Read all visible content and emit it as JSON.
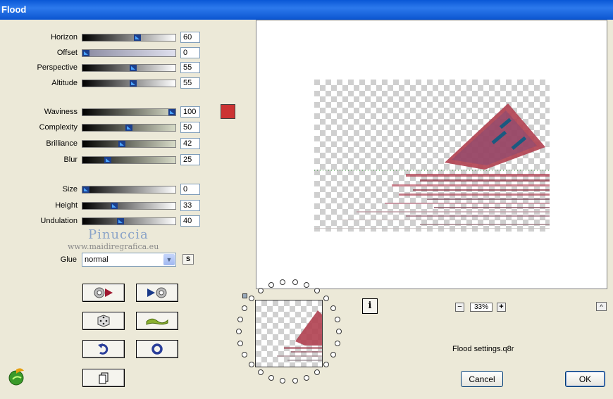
{
  "window": {
    "title": "Flood"
  },
  "sliders": [
    {
      "id": "horizon",
      "label": "Horizon",
      "value": "60",
      "fill": 0.6,
      "gradient": "linear-gradient(to right,#000,#fff)"
    },
    {
      "id": "offset",
      "label": "Offset",
      "value": "0",
      "fill": 0.0,
      "gradient": "linear-gradient(to right,#8a8aa0,#dfe0ee)"
    },
    {
      "id": "perspective",
      "label": "Perspective",
      "value": "55",
      "fill": 0.55,
      "gradient": "linear-gradient(to right,#000,#fff)"
    },
    {
      "id": "altitude",
      "label": "Altitude",
      "value": "55",
      "fill": 0.55,
      "gradient": "linear-gradient(to right,#000,#fff)"
    },
    {
      "id": "waviness",
      "label": "Waviness",
      "value": "100",
      "fill": 1.0,
      "gradient": "linear-gradient(to right,#000,#d8dcc8)"
    },
    {
      "id": "complexity",
      "label": "Complexity",
      "value": "50",
      "fill": 0.5,
      "gradient": "linear-gradient(to right,#000,#d8dcc8)"
    },
    {
      "id": "brilliance",
      "label": "Brilliance",
      "value": "42",
      "fill": 0.42,
      "gradient": "linear-gradient(to right,#000,#d8dcc8)"
    },
    {
      "id": "blur",
      "label": "Blur",
      "value": "25",
      "fill": 0.25,
      "gradient": "linear-gradient(to right,#000,#d8dcc8)"
    },
    {
      "id": "size",
      "label": "Size",
      "value": "0",
      "fill": 0.0,
      "gradient": "linear-gradient(to right,#000,#fff)"
    },
    {
      "id": "height",
      "label": "Height",
      "value": "33",
      "fill": 0.33,
      "gradient": "linear-gradient(to right,#000,#fff)"
    },
    {
      "id": "undulation",
      "label": "Undulation",
      "value": "40",
      "fill": 0.4,
      "gradient": "linear-gradient(to right,#000,#fff)"
    }
  ],
  "color_swatch": "#cc3333",
  "watermark": {
    "name": "Pinuccia",
    "url": "www.maidiregrafica.eu"
  },
  "glue": {
    "label": "Glue",
    "value": "normal",
    "s_button": "S"
  },
  "zoom": {
    "value": "33%",
    "minus": "−",
    "plus": "+"
  },
  "info_button": "i",
  "collapse_button": "^",
  "settings_file": "Flood settings.q8r",
  "buttons": {
    "cancel": "Cancel",
    "ok": "OK"
  },
  "icons": [
    "dial-left-icon",
    "dial-right-icon",
    "dice-icon",
    "wave-icon",
    "undo-icon",
    "ring-icon",
    "copy-icon",
    "plugin-logo-icon"
  ]
}
